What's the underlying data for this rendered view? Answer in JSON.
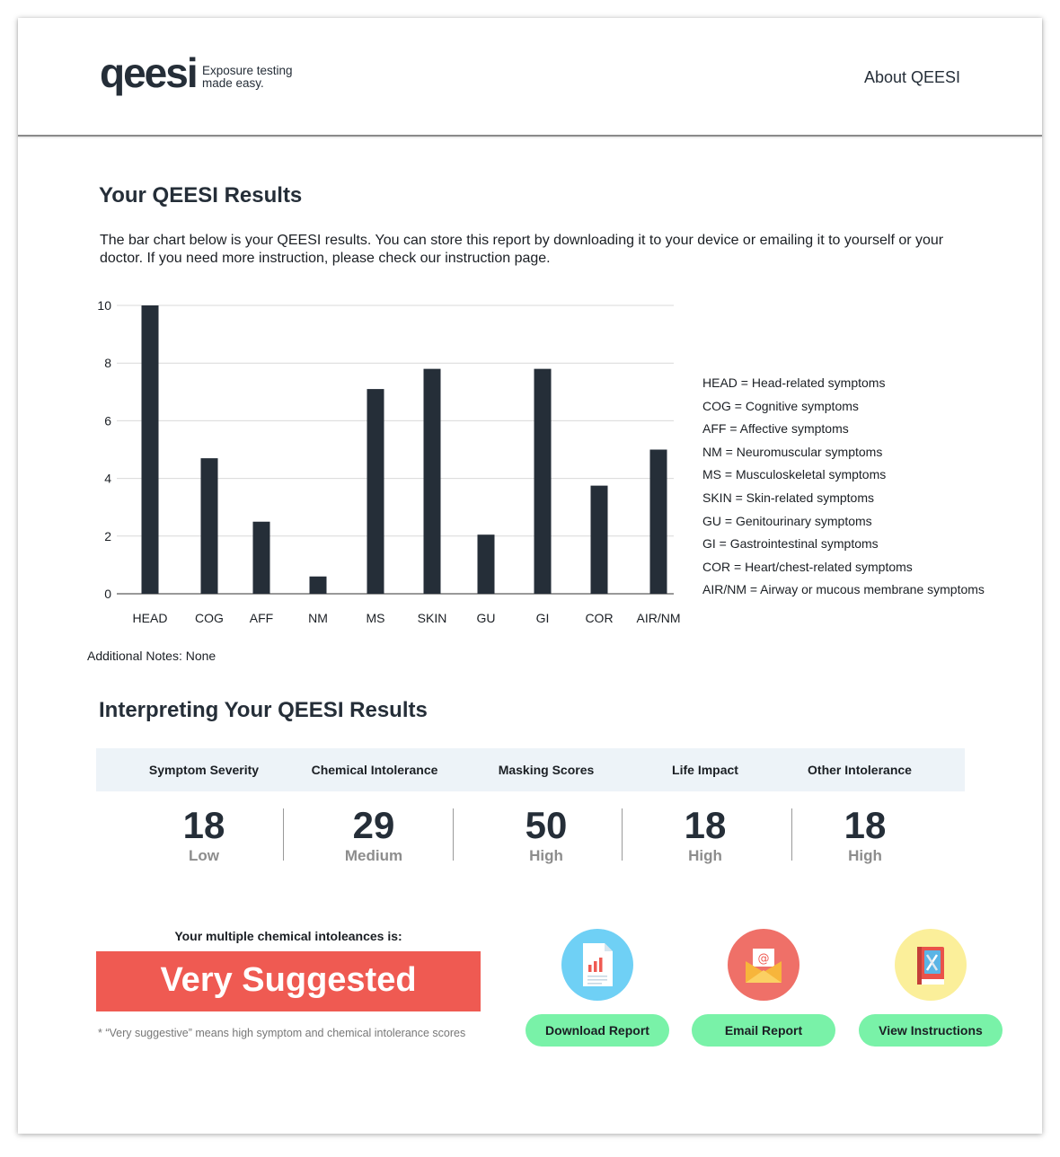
{
  "header": {
    "logo_text": "qeesi",
    "tagline_line1": "Exposure testing",
    "tagline_line2": "made easy.",
    "about_link": "About QEESI"
  },
  "results": {
    "title": "Your QEESI Results",
    "intro": "The bar chart below is your QEESI results. You can store this report by downloading it to your device or emailing it to yourself or your doctor. If you need more instruction, please check our instruction page.",
    "notes": "Additional Notes: None"
  },
  "chart_data": {
    "type": "bar",
    "categories": [
      "HEAD",
      "COG",
      "AFF",
      "NM",
      "MS",
      "SKIN",
      "GU",
      "GI",
      "COR",
      "AIR/NM"
    ],
    "values": [
      10,
      4.7,
      2.5,
      0.6,
      7.1,
      7.8,
      2.05,
      7.8,
      3.75,
      5.0
    ],
    "ylim": [
      0,
      10
    ],
    "yticks": [
      0,
      2,
      4,
      6,
      8,
      10
    ],
    "grid": true,
    "bar_color": "#252e38",
    "grid_color": "#d9d9d9",
    "title": "",
    "xlabel": "",
    "ylabel": ""
  },
  "legend": [
    "HEAD = Head-related symptoms",
    "COG = Cognitive symptoms",
    "AFF = Affective symptoms",
    "NM = Neuromuscular symptoms",
    "MS = Musculoskeletal symptoms",
    "SKIN = Skin-related symptoms",
    "GU = Genitourinary symptoms",
    "GI = Gastrointestinal symptoms",
    "COR = Heart/chest-related symptoms",
    "AIR/NM = Airway or mucous membrane symptoms"
  ],
  "interpret": {
    "title": "Interpreting Your QEESI Results",
    "metrics": [
      {
        "label": "Symptom Severity",
        "value": "18",
        "level": "Low"
      },
      {
        "label": "Chemical Intolerance",
        "value": "29",
        "level": "Medium"
      },
      {
        "label": "Masking Scores",
        "value": "50",
        "level": "High"
      },
      {
        "label": "Life Impact",
        "value": "18",
        "level": "High"
      },
      {
        "label": "Other Intolerance",
        "value": "18",
        "level": "High"
      }
    ]
  },
  "verdict": {
    "label": "Your multiple chemical intoleances is:",
    "value": "Very Suggested",
    "footnote": "* “Very suggestive” means high symptom and chemical intolerance scores",
    "color": "#ef5a52"
  },
  "actions": [
    {
      "label": "Download Report",
      "icon": "report-icon",
      "circle_color": "#6fd0f5"
    },
    {
      "label": "Email Report",
      "icon": "email-icon",
      "circle_color": "#ef7068"
    },
    {
      "label": "View Instructions",
      "icon": "instructions-book-icon",
      "circle_color": "#fbef9a"
    }
  ],
  "button_color": "#79f2a8"
}
